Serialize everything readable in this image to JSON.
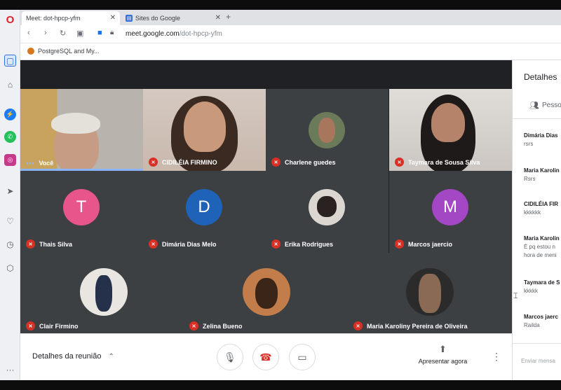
{
  "browser": {
    "tabs": [
      {
        "label": "Meet: dot-hpcp-yfm",
        "active": true
      },
      {
        "label": "Sites do Google",
        "active": false
      }
    ],
    "url_host": "meet.google.com",
    "url_path": "/dot-hpcp-yfm",
    "bookmark": "PostgreSQL and My..."
  },
  "participants": [
    {
      "name": "Você",
      "mic_muted": false,
      "speaking": true
    },
    {
      "name": "CIDILÉIA FIRMINO",
      "mic_muted": true
    },
    {
      "name": "Charlene guedes",
      "mic_muted": true
    },
    {
      "name": "Taymara de Sousa Silva",
      "mic_muted": true
    },
    {
      "name": "Thais Silva",
      "mic_muted": true,
      "initial": "T",
      "color": "#e8558a"
    },
    {
      "name": "Dimária Dias Melo",
      "mic_muted": true,
      "initial": "D",
      "color": "#1e63b8"
    },
    {
      "name": "Erika Rodrigues",
      "mic_muted": true
    },
    {
      "name": "Marcos jaercio",
      "mic_muted": true,
      "initial": "M",
      "color": "#a447c4"
    },
    {
      "name": "Clair Firmino",
      "mic_muted": true
    },
    {
      "name": "Zelina Bueno",
      "mic_muted": true
    },
    {
      "name": "Maria Karoliny Pereira de Oliveira",
      "mic_muted": true
    }
  ],
  "toolbar": {
    "details_label": "Detalhes da reunião",
    "present_label": "Apresentar agora"
  },
  "panel": {
    "title": "Detalhes",
    "tab_label": "Pesso",
    "messages": [
      {
        "who": "Dimária Dias",
        "text": "rsrs"
      },
      {
        "who": "Maria Karolin",
        "text": "Rsrs"
      },
      {
        "who": "CIDILÉIA FIR",
        "text": "kkkkkk"
      },
      {
        "who": "Maria Karolin",
        "text": "É pq estou n",
        "text2": "hora de meni"
      },
      {
        "who": "Taymara de S",
        "text": "kkkkk"
      },
      {
        "who": "Marcos jaerc",
        "text": "Railda"
      }
    ],
    "input_placeholder": "Enviar mensa"
  },
  "colors": {
    "meet_bg": "#202124",
    "tile_bg": "#3c4043",
    "mic_off": "#d93025",
    "accent": "#8ab4f8"
  }
}
